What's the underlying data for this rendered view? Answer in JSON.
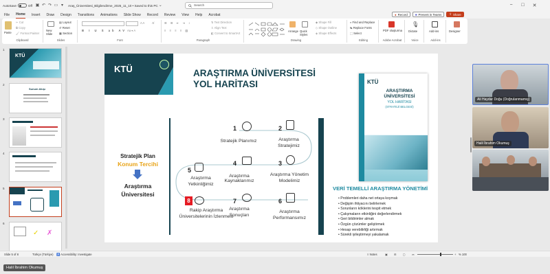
{
  "titlebar": {
    "autosave_label": "AutoSave",
    "autosave_state": "Off",
    "filename": "Araş_Üniversitesi_Bilgilendirme_2025_11_10 • Saved to this PC",
    "search_placeholder": "Search"
  },
  "menu": {
    "items": [
      "File",
      "Home",
      "Insert",
      "Draw",
      "Design",
      "Transitions",
      "Animations",
      "Slide Show",
      "Record",
      "Review",
      "View",
      "Help",
      "Acrobat"
    ],
    "active": "Home",
    "record_label": "Record",
    "present_label": "Present in Teams",
    "share_label": "Share"
  },
  "ribbon": {
    "groups": [
      "Clipboard",
      "Slides",
      "Font",
      "Paragraph",
      "Drawing",
      "Editing",
      "Adobe Acrobat",
      "Voice",
      "Add-ins"
    ],
    "paste": "Paste",
    "cut": "Cut",
    "copy": "Copy",
    "format_painter": "Format Painter",
    "new_slide": "New Slide",
    "layout": "Layout",
    "reset": "Reset",
    "section": "Section",
    "font_name": "",
    "font_size": "",
    "text_direction": "Text Direction",
    "align_text": "Align Text",
    "convert_smartart": "Convert to SmartArt",
    "arrange": "Arrange",
    "quick_styles": "Quick Styles",
    "shape_fill": "Shape Fill",
    "shape_outline": "Shape Outline",
    "shape_effects": "Shape Effects",
    "find_replace": "Find and Replace",
    "replace_fonts": "Replace Fonts",
    "select": "Select",
    "pdf": "PDF oluşturma",
    "dictate": "Dictate",
    "addins": "Add-ins",
    "designer": "Designer"
  },
  "thumbnails": {
    "numbers": [
      "1",
      "2",
      "3",
      "4",
      "5",
      "6"
    ],
    "selected": 5,
    "thumb2_title": "Sunum Akışı",
    "thumb6_yes": "✓",
    "thumb6_no": "✗"
  },
  "slide": {
    "logo": "KTÜ",
    "title_line1": "ARAŞTIRMA ÜNİVERSİTESİ",
    "title_line2": "YOL HARİTASI",
    "left_line1": "Stratejik Plan",
    "left_line2": "Konum Tercihi",
    "left_line3": "Araştırma",
    "left_line4": "Üniversitesi",
    "steps": [
      {
        "num": "1",
        "label": "Stratejik Planımız"
      },
      {
        "num": "2",
        "label": "Araştırma Stratejimiz"
      },
      {
        "num": "3",
        "label": "Araştırma Yönetim Modelimiz"
      },
      {
        "num": "4",
        "label": "Araştırma Kaynaklarımız"
      },
      {
        "num": "5",
        "label": "Araştırma Yetkinliğimiz"
      },
      {
        "num": "6",
        "label": "Araştırma Performansımız"
      },
      {
        "num": "7",
        "label": "Araştırma Sonuçları"
      },
      {
        "num": "8",
        "label": "Rakip Araştırma Üniversitelerinin İzlenmesi"
      }
    ],
    "cover_logo": "KTÜ",
    "cover_title1": "ARAŞTIRMA",
    "cover_title2": "ÜNİVERSİTESİ",
    "cover_title3": "YOL HARİTASI",
    "cover_title4": "(STRATEJİ BELGESİ)",
    "right_heading": "VERİ TEMELLİ ARAŞTIRMA YÖNETİMİ",
    "bullets": [
      "Problemleri daha net ortaya koymak",
      "Değişim ihtiyacını belirlemek",
      "Sorunların köklerini tespit etmek",
      "Çalışmaların etkinliğini değerlendirmek",
      "Geri bildirimler almak",
      "Özgün çözümler geliştirmek",
      "Hesap verebilirliği artırmak",
      "Sürekli iyileştirmeyi yakalamak"
    ]
  },
  "status": {
    "slide_count": "Slide 5 of 8",
    "language": "Türkçe (Türkiye)",
    "accessibility": "Accessibility: Investigate",
    "notes": "Notes",
    "zoom": "% 100"
  },
  "participants": [
    {
      "name": "Ali Haydar Doğu (Doğrulanmamış)"
    },
    {
      "name": "Halil İbrahim Okumuş"
    },
    {
      "name": ""
    }
  ],
  "active_speaker": "Halil İbrahim Okumuş",
  "colors": {
    "accent": "#c43e1c",
    "slide_dark": "#16434f",
    "slide_teal": "#1e8aa0",
    "highlight": "#e8a317",
    "red_badge": "#e51b23",
    "arrow_blue": "#4472c4"
  }
}
